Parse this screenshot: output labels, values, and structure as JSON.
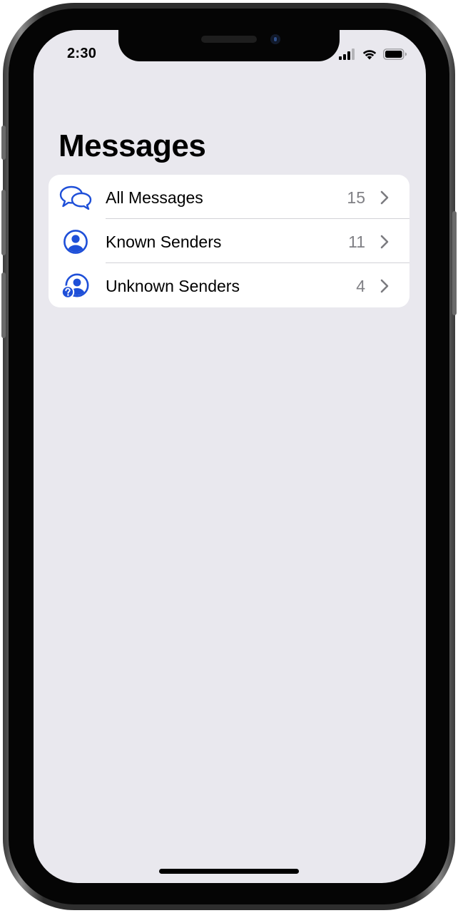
{
  "status_bar": {
    "time": "2:30",
    "icons": [
      "cellular-signal-icon",
      "wifi-icon",
      "battery-icon"
    ]
  },
  "header": {
    "title": "Messages"
  },
  "list": {
    "items": [
      {
        "label": "All Messages",
        "count": "15",
        "icon": "chat-bubbles-icon"
      },
      {
        "label": "Known Senders",
        "count": "11",
        "icon": "person-circle-icon"
      },
      {
        "label": "Unknown Senders",
        "count": "4",
        "icon": "person-question-icon"
      }
    ]
  },
  "colors": {
    "accent": "#1e4fd8",
    "background": "#e9e8ee",
    "card": "#ffffff",
    "secondary_text": "#808085",
    "chevron": "#7b7b80"
  }
}
